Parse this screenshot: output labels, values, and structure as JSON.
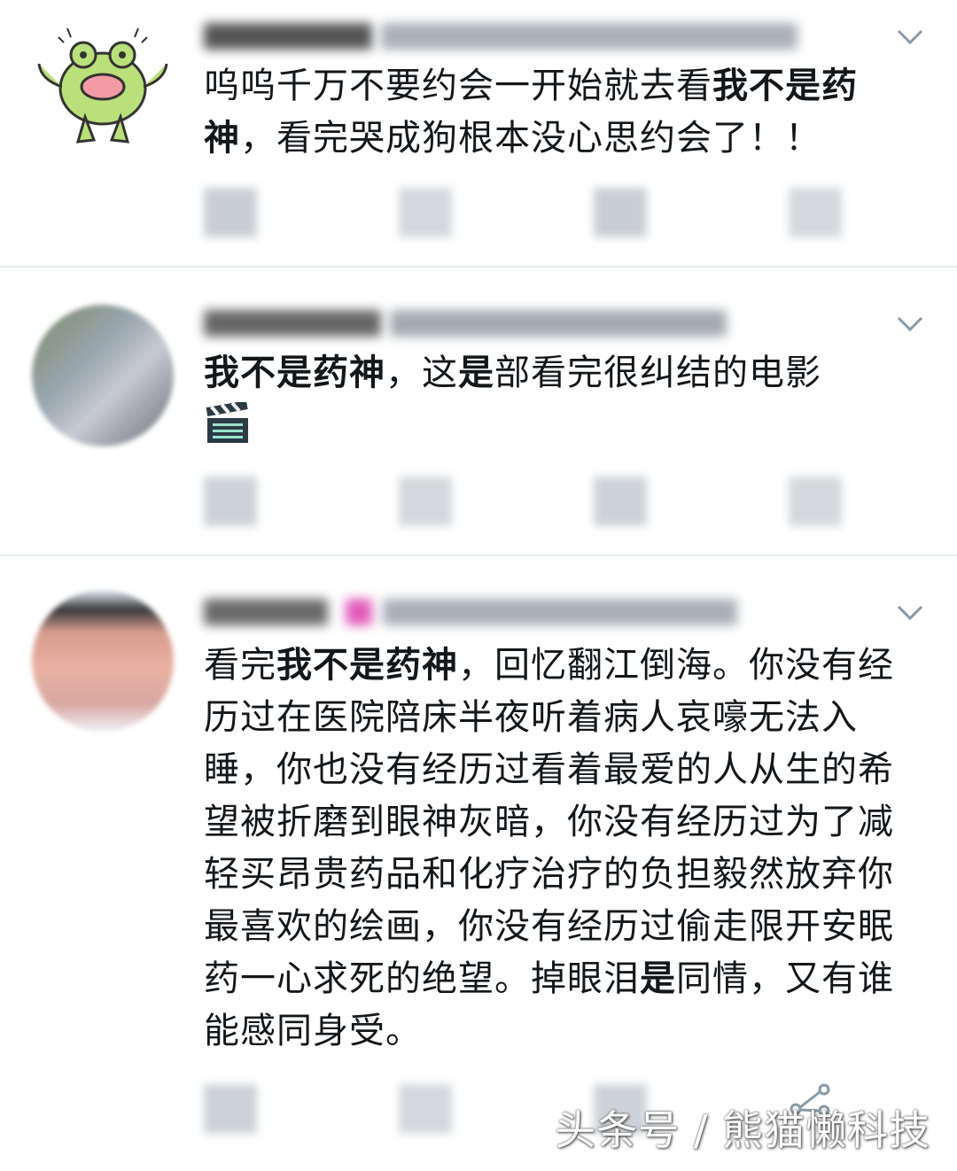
{
  "tweets": [
    {
      "avatar": "frog-avatar",
      "segments": [
        {
          "t": "呜呜千万不要约会一开始就去看",
          "b": false
        },
        {
          "t": "我不是药神",
          "b": true
        },
        {
          "t": "，看完哭成狗根本没心思约会了！！",
          "b": false
        }
      ]
    },
    {
      "avatar": "pixelated-avatar",
      "segments": [
        {
          "t": "我不是药神",
          "b": true
        },
        {
          "t": "，这",
          "b": false
        },
        {
          "t": "是",
          "b": true
        },
        {
          "t": "部看完很纠结的电影",
          "b": false
        }
      ],
      "emoji": "clapper-board-icon"
    },
    {
      "avatar": "pixelated-face-avatar",
      "segments": [
        {
          "t": "看完",
          "b": false
        },
        {
          "t": "我不是药神",
          "b": true
        },
        {
          "t": "，回忆翻江倒海。你没有经历过在医院陪床半夜听着病人哀嚎无法入睡，你也没有经历过看着最爱的人从生的希望被折磨到眼神灰暗，你没有经历过为了减轻买昂贵药品和化疗治疗的负担毅然放弃你最喜欢的绘画，你没有经历过偷走限开安眠药一心求死的绝望。掉眼泪",
          "b": false
        },
        {
          "t": "是",
          "b": true
        },
        {
          "t": "同情，又有谁能感同身受。",
          "b": false
        }
      ]
    }
  ],
  "watermark": "头条号 / 熊猫懒科技",
  "colors": {
    "divider": "#e6ecf0",
    "chevron": "#8899a6",
    "frog": "#b9e07a"
  }
}
